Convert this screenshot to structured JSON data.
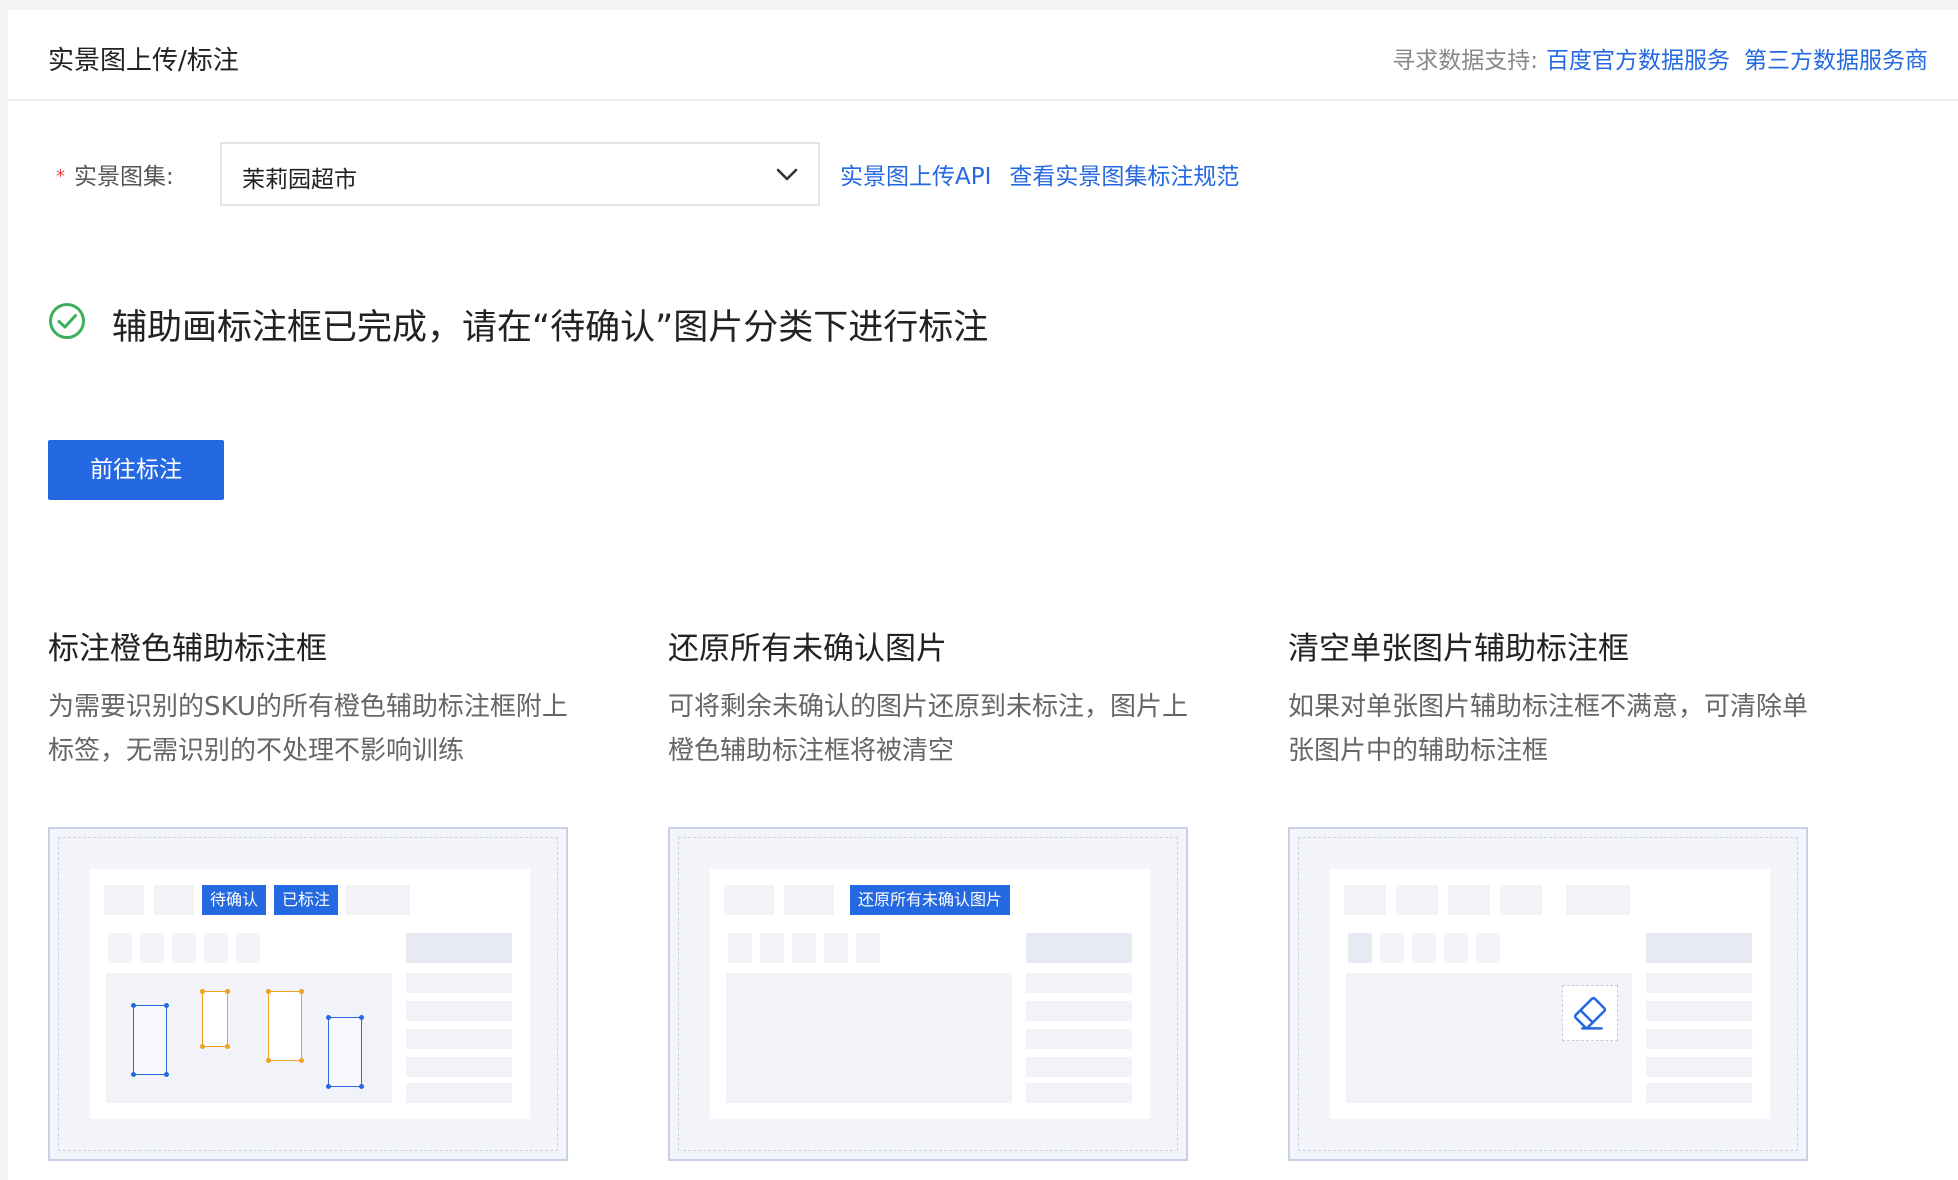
{
  "header": {
    "title": "实景图上传/标注",
    "support_label": "寻求数据支持:",
    "links": [
      "百度官方数据服务",
      "第三方数据服务商"
    ]
  },
  "form": {
    "required_mark": "*",
    "label": "实景图集:",
    "selected": "茉莉园超市",
    "links": [
      "实景图上传API",
      "查看实景图集标注规范"
    ]
  },
  "status": {
    "message": "辅助画标注框已完成，请在“待确认”图片分类下进行标注",
    "icon": "check-circle-icon",
    "color": "#3fae5a"
  },
  "primary_button": "前往标注",
  "colors": {
    "accent": "#2468e2",
    "orange_box": "#f0a020"
  },
  "cards": [
    {
      "title": "标注橙色辅助标注框",
      "description": "为需要识别的SKU的所有橙色辅助标注框附上标签，无需识别的不处理不影响训练",
      "tags": [
        "待确认",
        "已标注"
      ]
    },
    {
      "title": "还原所有未确认图片",
      "description": "可将剩余未确认的图片还原到未标注，图片上橙色辅助标注框将被清空",
      "tags": [
        "还原所有未确认图片"
      ]
    },
    {
      "title": "清空单张图片辅助标注框",
      "description": "如果对单张图片辅助标注框不满意，可清除单张图片中的辅助标注框",
      "icon": "eraser-icon"
    }
  ]
}
